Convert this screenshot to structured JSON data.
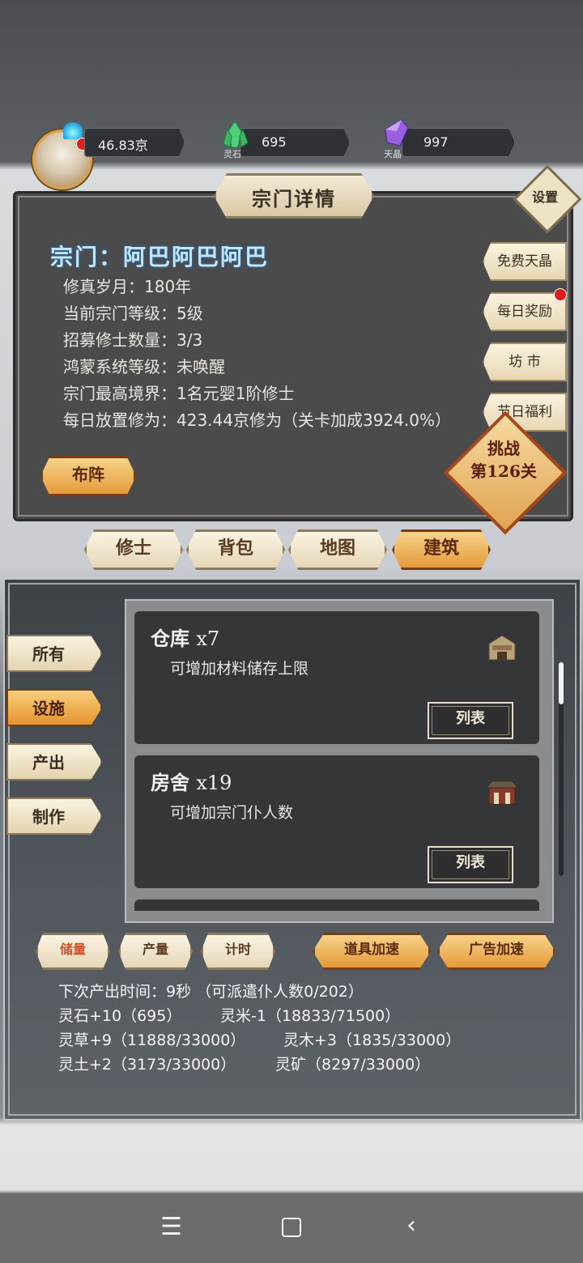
{
  "resources": {
    "power": "46.83京",
    "spirit_stone": {
      "value": "695",
      "label": "灵石"
    },
    "crystal": {
      "value": "997",
      "label": "天晶"
    }
  },
  "header": {
    "title": "宗门详情",
    "settings_label": "设置"
  },
  "sect": {
    "name": "宗门：阿巴阿巴阿巴",
    "lines": [
      "修真岁月：180年",
      "当前宗门等级：5级",
      "招募修士数量：3/3",
      "鸿蒙系统等级：未唤醒",
      "宗门最高境界：1名元婴1阶修士",
      "每日放置修为：423.44京修为（关卡加成3924.0%）"
    ]
  },
  "side_buttons": [
    "免费天晶",
    "每日奖励",
    "坊 市",
    "节日福利"
  ],
  "formation_label": "布阵",
  "challenge": {
    "line1": "挑战",
    "line2": "第126关"
  },
  "main_tabs": [
    "修士",
    "背包",
    "地图",
    "建筑"
  ],
  "categories": [
    "所有",
    "设施",
    "产出",
    "制作"
  ],
  "buildings": [
    {
      "name": "仓库",
      "count": "x7",
      "desc": "可增加材料储存上限",
      "button": "列表"
    },
    {
      "name": "房舍",
      "count": "x19",
      "desc": "可增加宗门仆人数",
      "button": "列表"
    }
  ],
  "bottom_tabs": [
    "储量",
    "产量",
    "计时"
  ],
  "speed_buttons": [
    "道具加速",
    "广告加速"
  ],
  "output": {
    "next_time": "下次产出时间：9秒 （可派遣仆人数0/202）",
    "rows": [
      [
        "灵石+10（695）",
        "灵米-1（18833/71500）"
      ],
      [
        "灵草+9（11888/33000）",
        "灵木+3（1835/33000）"
      ],
      [
        "灵土+2（3173/33000）",
        "灵矿（8297/33000）"
      ]
    ]
  },
  "colors": {
    "accent_orange": "#e5942f",
    "panel": "#4b4b4b",
    "sect_name": "#bfe6ff",
    "red_dot": "#e01c1c"
  }
}
